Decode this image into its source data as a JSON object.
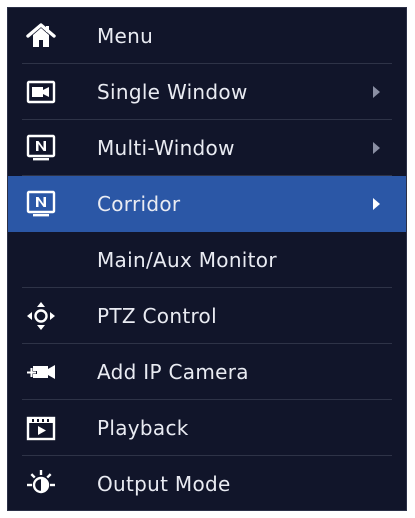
{
  "menu": {
    "items": [
      {
        "label": "Menu",
        "icon": "home-icon"
      },
      {
        "label": "Single Window",
        "icon": "single-window-icon",
        "submenu": true
      },
      {
        "label": "Multi-Window",
        "icon": "multi-window-icon",
        "submenu": true
      },
      {
        "label": "Corridor",
        "icon": "corridor-icon",
        "submenu": true,
        "active": true
      },
      {
        "label": "Main/Aux Monitor"
      },
      {
        "label": "PTZ Control",
        "icon": "ptz-control-icon"
      },
      {
        "label": "Add IP Camera",
        "icon": "add-ip-camera-icon"
      },
      {
        "label": "Playback",
        "icon": "playback-icon"
      },
      {
        "label": "Output Mode",
        "icon": "output-mode-icon"
      }
    ]
  },
  "colors": {
    "menu_background": "#11152a",
    "active_background": "#2b57a6",
    "text": "#e9ebf2",
    "chevron": "#8a8fa3"
  }
}
